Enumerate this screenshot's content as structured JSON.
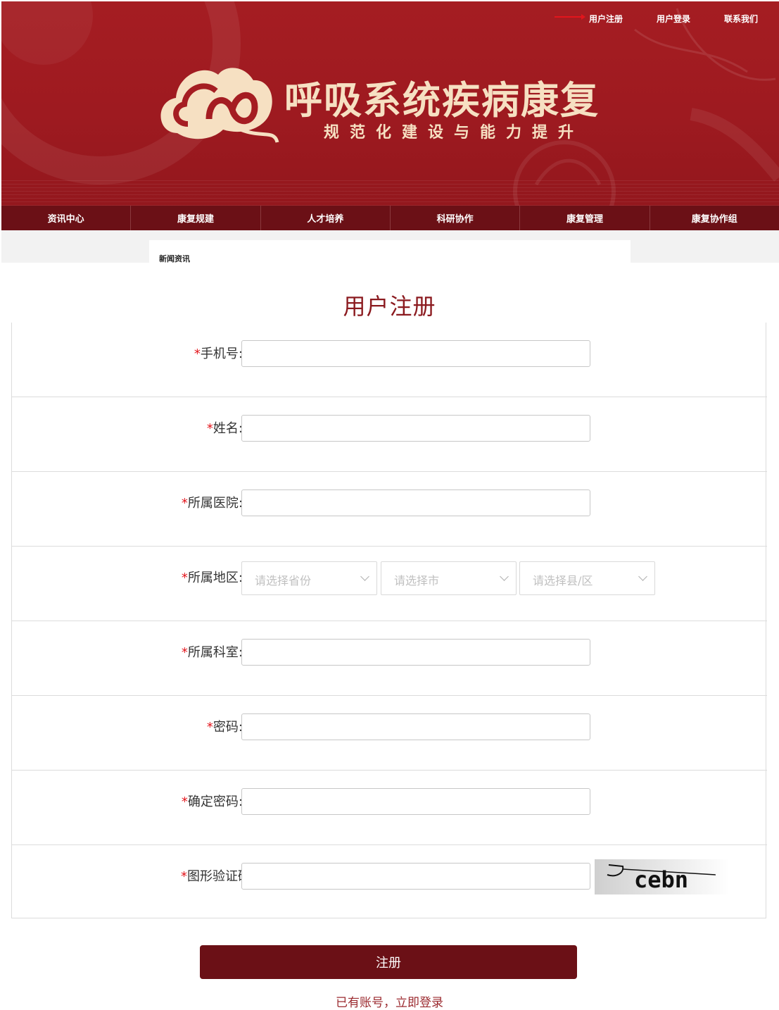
{
  "header": {
    "links": [
      {
        "label": "用户注册"
      },
      {
        "label": "用户登录"
      },
      {
        "label": "联系我们"
      }
    ],
    "title": "呼吸系统疾病康复",
    "subtitle": "规范化建设与能力提升"
  },
  "nav": {
    "items": [
      {
        "label": "资讯中心"
      },
      {
        "label": "康复规建"
      },
      {
        "label": "人才培养"
      },
      {
        "label": "科研协作"
      },
      {
        "label": "康复管理"
      },
      {
        "label": "康复协作组"
      }
    ]
  },
  "breadcrumb": {
    "label": "新闻资讯"
  },
  "form": {
    "title": "用户注册",
    "required_mark": "*",
    "fields": [
      {
        "label": "手机号:",
        "value": ""
      },
      {
        "label": "姓名:",
        "value": ""
      },
      {
        "label": "所属医院:",
        "value": ""
      },
      {
        "label": "所属地区:"
      },
      {
        "label": "所属科室:",
        "value": ""
      },
      {
        "label": "密码:",
        "value": ""
      },
      {
        "label": "确定密码:",
        "value": ""
      },
      {
        "label": "图形验证码",
        "value": ""
      }
    ],
    "region_selects": [
      {
        "placeholder": "请选择省份"
      },
      {
        "placeholder": "请选择市"
      },
      {
        "placeholder": "请选择县/区"
      }
    ],
    "captcha_text": "cebn",
    "submit_label": "注册",
    "login_link": "已有账号，立即登录"
  },
  "colors": {
    "header_red": "#a51d22",
    "nav_dark": "#6b1016",
    "title_red": "#8b1a1f",
    "required": "#e3151c",
    "title_gold": "#f6e0c2"
  }
}
